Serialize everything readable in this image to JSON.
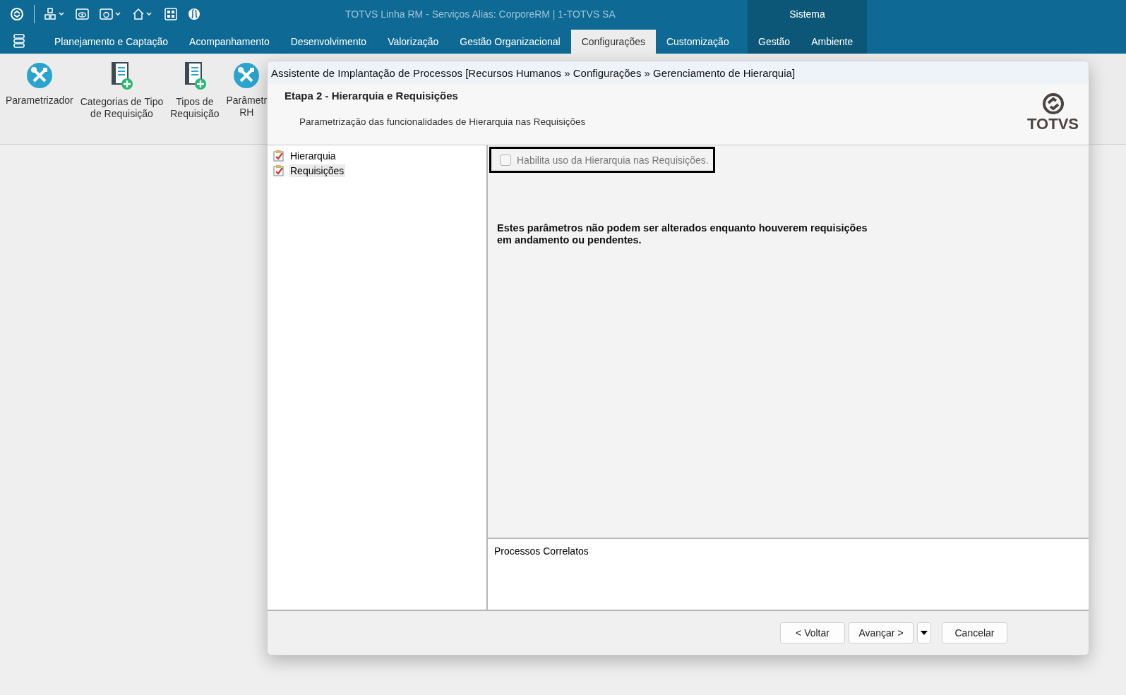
{
  "window": {
    "title": "TOTVS Linha RM - Serviços  Alias: CorporeRM | 1-TOTVS SA",
    "system_label": "Sistema"
  },
  "menu_tabs": [
    {
      "label": "Planejamento e Captação",
      "selected": false,
      "kind": "main"
    },
    {
      "label": "Acompanhamento",
      "selected": false,
      "kind": "main"
    },
    {
      "label": "Desenvolvimento",
      "selected": false,
      "kind": "main"
    },
    {
      "label": "Valorização",
      "selected": false,
      "kind": "main"
    },
    {
      "label": "Gestão Organizacional",
      "selected": false,
      "kind": "main"
    },
    {
      "label": "Configurações",
      "selected": true,
      "kind": "main"
    },
    {
      "label": "Customização",
      "selected": false,
      "kind": "main"
    },
    {
      "label": "Gestão",
      "selected": false,
      "kind": "system"
    },
    {
      "label": "Ambiente",
      "selected": false,
      "kind": "system"
    }
  ],
  "ribbon": [
    {
      "kind": "tool",
      "lines": [
        "Parametrizador"
      ]
    },
    {
      "kind": "doc",
      "lines": [
        "Categorias de Tipo",
        "de Requisição"
      ]
    },
    {
      "kind": "doc",
      "lines": [
        "Tipos de",
        "Requisição"
      ]
    },
    {
      "kind": "tool",
      "lines": [
        "Parâmetr",
        "RH"
      ]
    }
  ],
  "dialog": {
    "title": "Assistente de Implantação de Processos [Recursos Humanos » Configurações » Gerenciamento de Hierarquia]",
    "step": "Etapa 2 - Hierarquia e Requisições",
    "subtitle": "Parametrização das funcionalidades de Hierarquia nas Requisições",
    "logo_text": "TOTVS",
    "tree": [
      {
        "label": "Hierarquia",
        "selected": false
      },
      {
        "label": "Requisições",
        "selected": true
      }
    ],
    "checkbox": {
      "label": "Habilita uso da Hierarquia nas Requisições.",
      "checked": false,
      "disabled": true
    },
    "warning": "Estes parâmetros não podem ser alterados enquanto houverem requisições em andamento ou pendentes.",
    "related_title": "Processos Correlatos",
    "buttons": {
      "back": "< Voltar",
      "next": "Avançar >",
      "cancel": "Cancelar"
    }
  }
}
